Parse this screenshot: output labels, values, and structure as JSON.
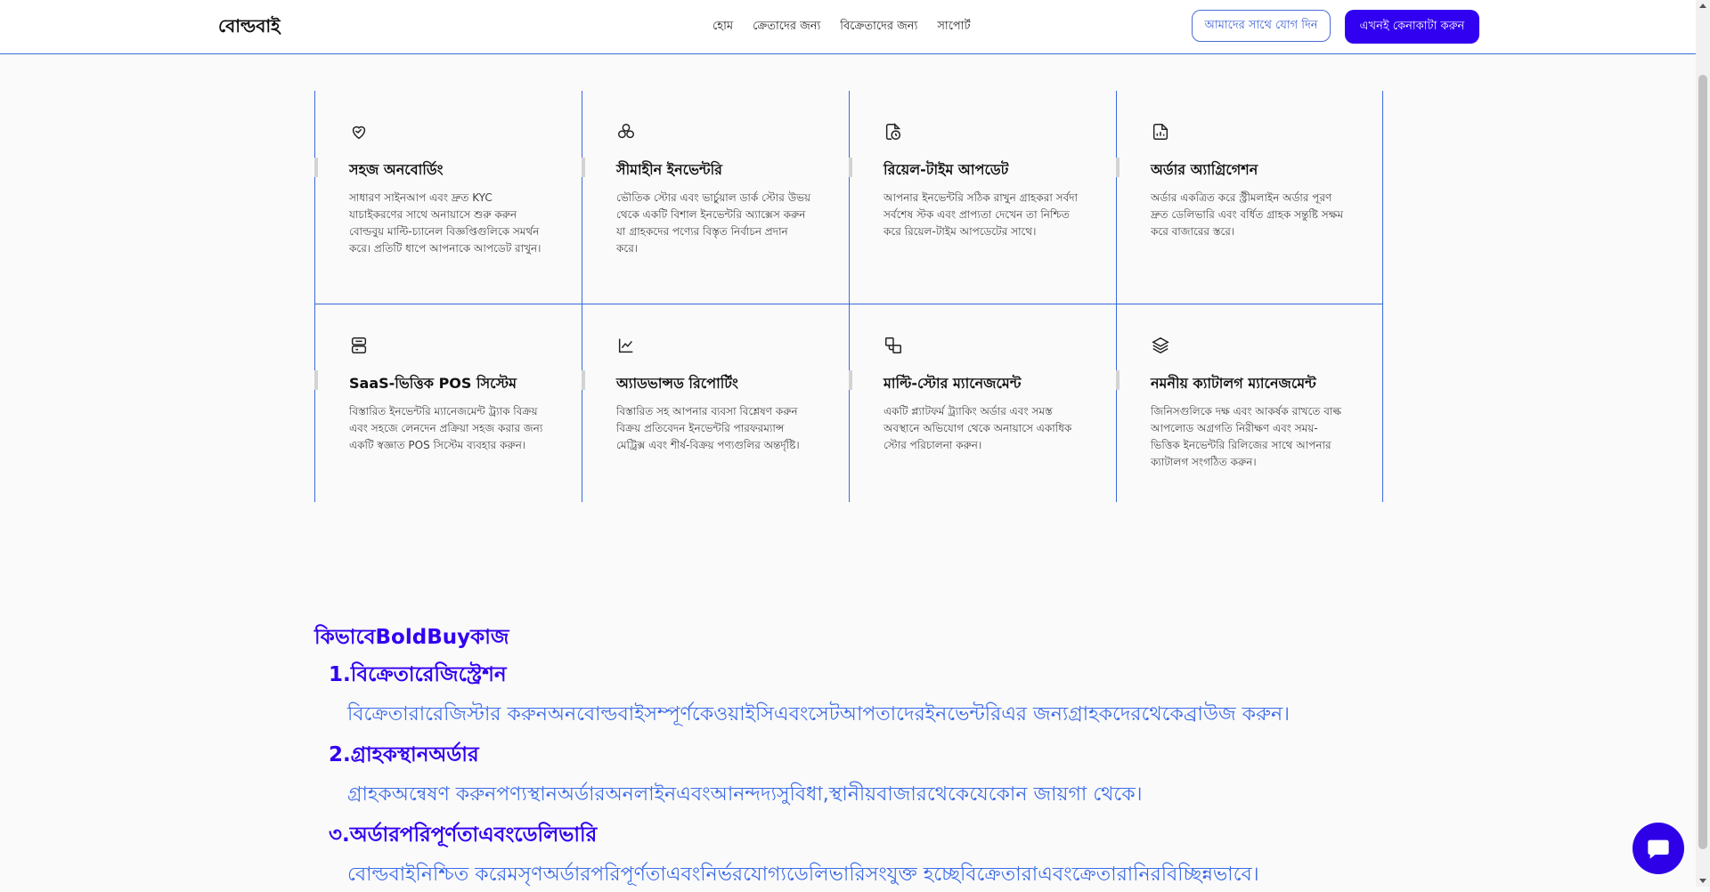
{
  "header": {
    "logo": "বোল্ডবাই",
    "nav": [
      "হোম",
      "ক্রেতাদের জন্য",
      "বিক্রেতাদের জন্য",
      "সাপোর্ট"
    ],
    "join_button": "আমাদের সাথে যোগ দিন",
    "buy_button": "এখনই কেনাকাটা করুন"
  },
  "features": [
    {
      "icon": "handshake-heart-icon",
      "title": "সহজ অনবোর্ডিং",
      "desc": "সাধারণ সাইনআপ এবং দ্রুত KYC যাচাইকরণের সাথে অনায়াসে শুরু করুন বোল্ডবুয় মাল্টি-চ্যানেল বিজ্ঞপ্তিগুলিকে সমর্থন করে। প্রতিটি ধাপে আপনাকে আপডেট রাখুন।"
    },
    {
      "icon": "cubes-icon",
      "title": "সীমাহীন ইনভেন্টরি",
      "desc": "ভৌতিক স্টোর এবং ভার্চুয়াল ডার্ক স্টোর উভয় থেকে একটি বিশাল ইনভেন্টরি অ্যাক্সেস করুন যা গ্রাহকদের পণ্যের বিস্তৃত নির্বাচন প্রদান করে।"
    },
    {
      "icon": "file-clock-icon",
      "title": "রিয়েল-টাইম আপডেট",
      "desc": "আপনার ইনভেন্টরি সঠিক রাখুন গ্রাহকরা সর্বদা সর্বশেষ স্টক এবং প্রাপ্যতা দেখেন তা নিশ্চিত করে রিয়েল-টাইম আপডেটের সাথে।"
    },
    {
      "icon": "file-chart-icon",
      "title": "অর্ডার অ্যাগ্রিগেশন",
      "desc": "অর্ডার একত্রিত করে স্ট্রীমলাইন অর্ডার পূরণ দ্রুত ডেলিভারি এবং বর্ধিত গ্রাহক সন্তুষ্টি সক্ষম করে বাজারের স্তরে।"
    },
    {
      "icon": "pos-terminal-icon",
      "title": "SaaS-ভিত্তিক POS সিস্টেম",
      "desc": "বিস্তারিত ইনভেন্টরি ম্যানেজমেন্ট ট্র্যাক বিক্রয় এবং সহজে লেনদেন প্রক্রিয়া সহজ করার জন্য একটি স্বজ্ঞাত POS সিস্টেম ব্যবহার করুন।"
    },
    {
      "icon": "line-chart-icon",
      "title": "অ্যাডভান্সড রিপোর্টিং",
      "desc": "বিস্তারিত সহ আপনার ব্যবসা বিশ্লেষণ করুন বিক্রয় প্রতিবেদন ইনভেন্টরি পারফরম্যান্স মেট্রিক্স এবং শীর্ষ-বিক্রয় পণ্যগুলির অন্তর্দৃষ্টি।"
    },
    {
      "icon": "multi-store-icon",
      "title": "মাল্টি-স্টোর ম্যানেজমেন্ট",
      "desc": "একটি প্ল্যাটফর্ম ট্র্যাকিং অর্ডার এবং সমস্ত অবস্থানে অভিযোগ থেকে অনায়াসে একাধিক স্টোর পরিচালনা করুন।"
    },
    {
      "icon": "layers-icon",
      "title": "নমনীয় ক্যাটালগ ম্যানেজমেন্ট",
      "desc": "জিনিসগুলিকে দক্ষ এবং আকর্ষক রাখতে বাল্ক আপলোড অগ্রগতি নিরীক্ষণ এবং সময়-ভিত্তিক ইনভেন্টরি রিলিজের সাথে আপনার ক্যাটালগ সংগঠিত করুন।"
    }
  ],
  "how": {
    "title": "কিভাবেBoldBuyকাজ",
    "steps": [
      {
        "title": "1.বিক্রেতারেজিস্ট্রেশন",
        "desc": "বিক্রেতারারেজিস্টার করুনঅনবোল্ডবাইসম্পূর্ণকেওয়াইসিএবংসেটআপতাদেরইনভেন্টরিএর জন্যগ্রাহকদেরথেকেব্রাউজ করুন।"
      },
      {
        "title": "2.গ্রাহকস্থানঅর্ডার",
        "desc": "গ্রাহকঅন্বেষণ করুনপণ্যস্থানঅর্ডারঅনলাইনএবংআনন্দদ্যসুবিধা,স্থানীয়বাজারথেকেযেকোন জায়গা থেকে।"
      },
      {
        "title": "৩.অর্ডারপরিপূর্ণতাএবংডেলিভারি",
        "desc": "বোল্ডবাইনিশ্চিত করেমসৃণঅর্ডারপরিপূর্ণতাএবংনির্ভরযোগ্যডেলিভারিসংযুক্ত হচ্ছেবিক্রেতারাএবংক্রেতারানিরবিচ্ছিন্নভাবে।"
      }
    ]
  },
  "colors": {
    "accent": "#3200f0",
    "border": "#3b6bdc",
    "step_text": "#3b6be8"
  }
}
